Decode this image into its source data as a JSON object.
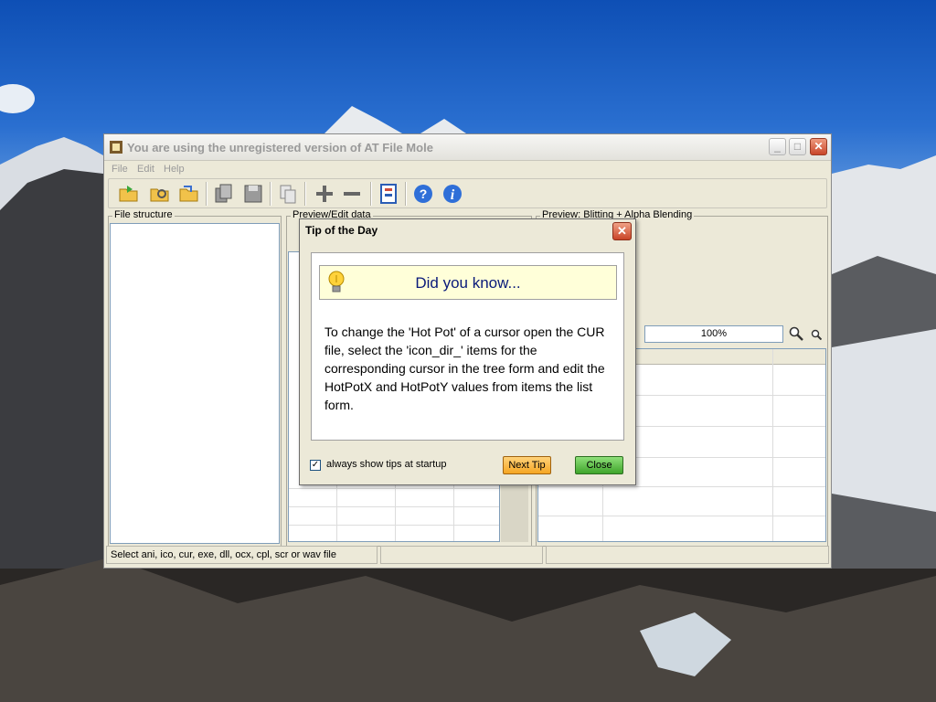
{
  "window": {
    "title": "You are using the unregistered version of AT File Mole",
    "controls": {
      "minimize": "_",
      "maximize": "□",
      "close": "✕"
    }
  },
  "menu": [
    "File",
    "Edit",
    "Help"
  ],
  "toolbar": {
    "icons": [
      "open-folder-icon",
      "browse-folder-icon",
      "open-recent-icon",
      "copy-pages-icon",
      "save-icon",
      "copy-icon",
      "add-icon",
      "remove-icon",
      "properties-icon",
      "help-icon",
      "info-icon"
    ]
  },
  "panels": {
    "file_structure": "File structure",
    "preview_edit": "Preview/Edit data",
    "preview_blitting": "Preview: Blitting + Alpha Blending"
  },
  "zoom": {
    "value": "100%"
  },
  "status": {
    "left": "Select ani, ico, cur, exe, dll, ocx, cpl, scr or wav file",
    "middle": "",
    "right": ""
  },
  "dialog": {
    "title": "Tip of the Day",
    "heading": "Did you know...",
    "tip": "To change the 'Hot Pot' of a cursor open the CUR file, select the 'icon_dir_' items for the corresponding cursor in the tree form and edit the HotPotX and HotPotY values from items the list form.",
    "checkbox_label": "always show tips at startup",
    "checkbox_checked": true,
    "next_label": "Next Tip",
    "close_label": "Close",
    "close_glyph": "✕"
  }
}
